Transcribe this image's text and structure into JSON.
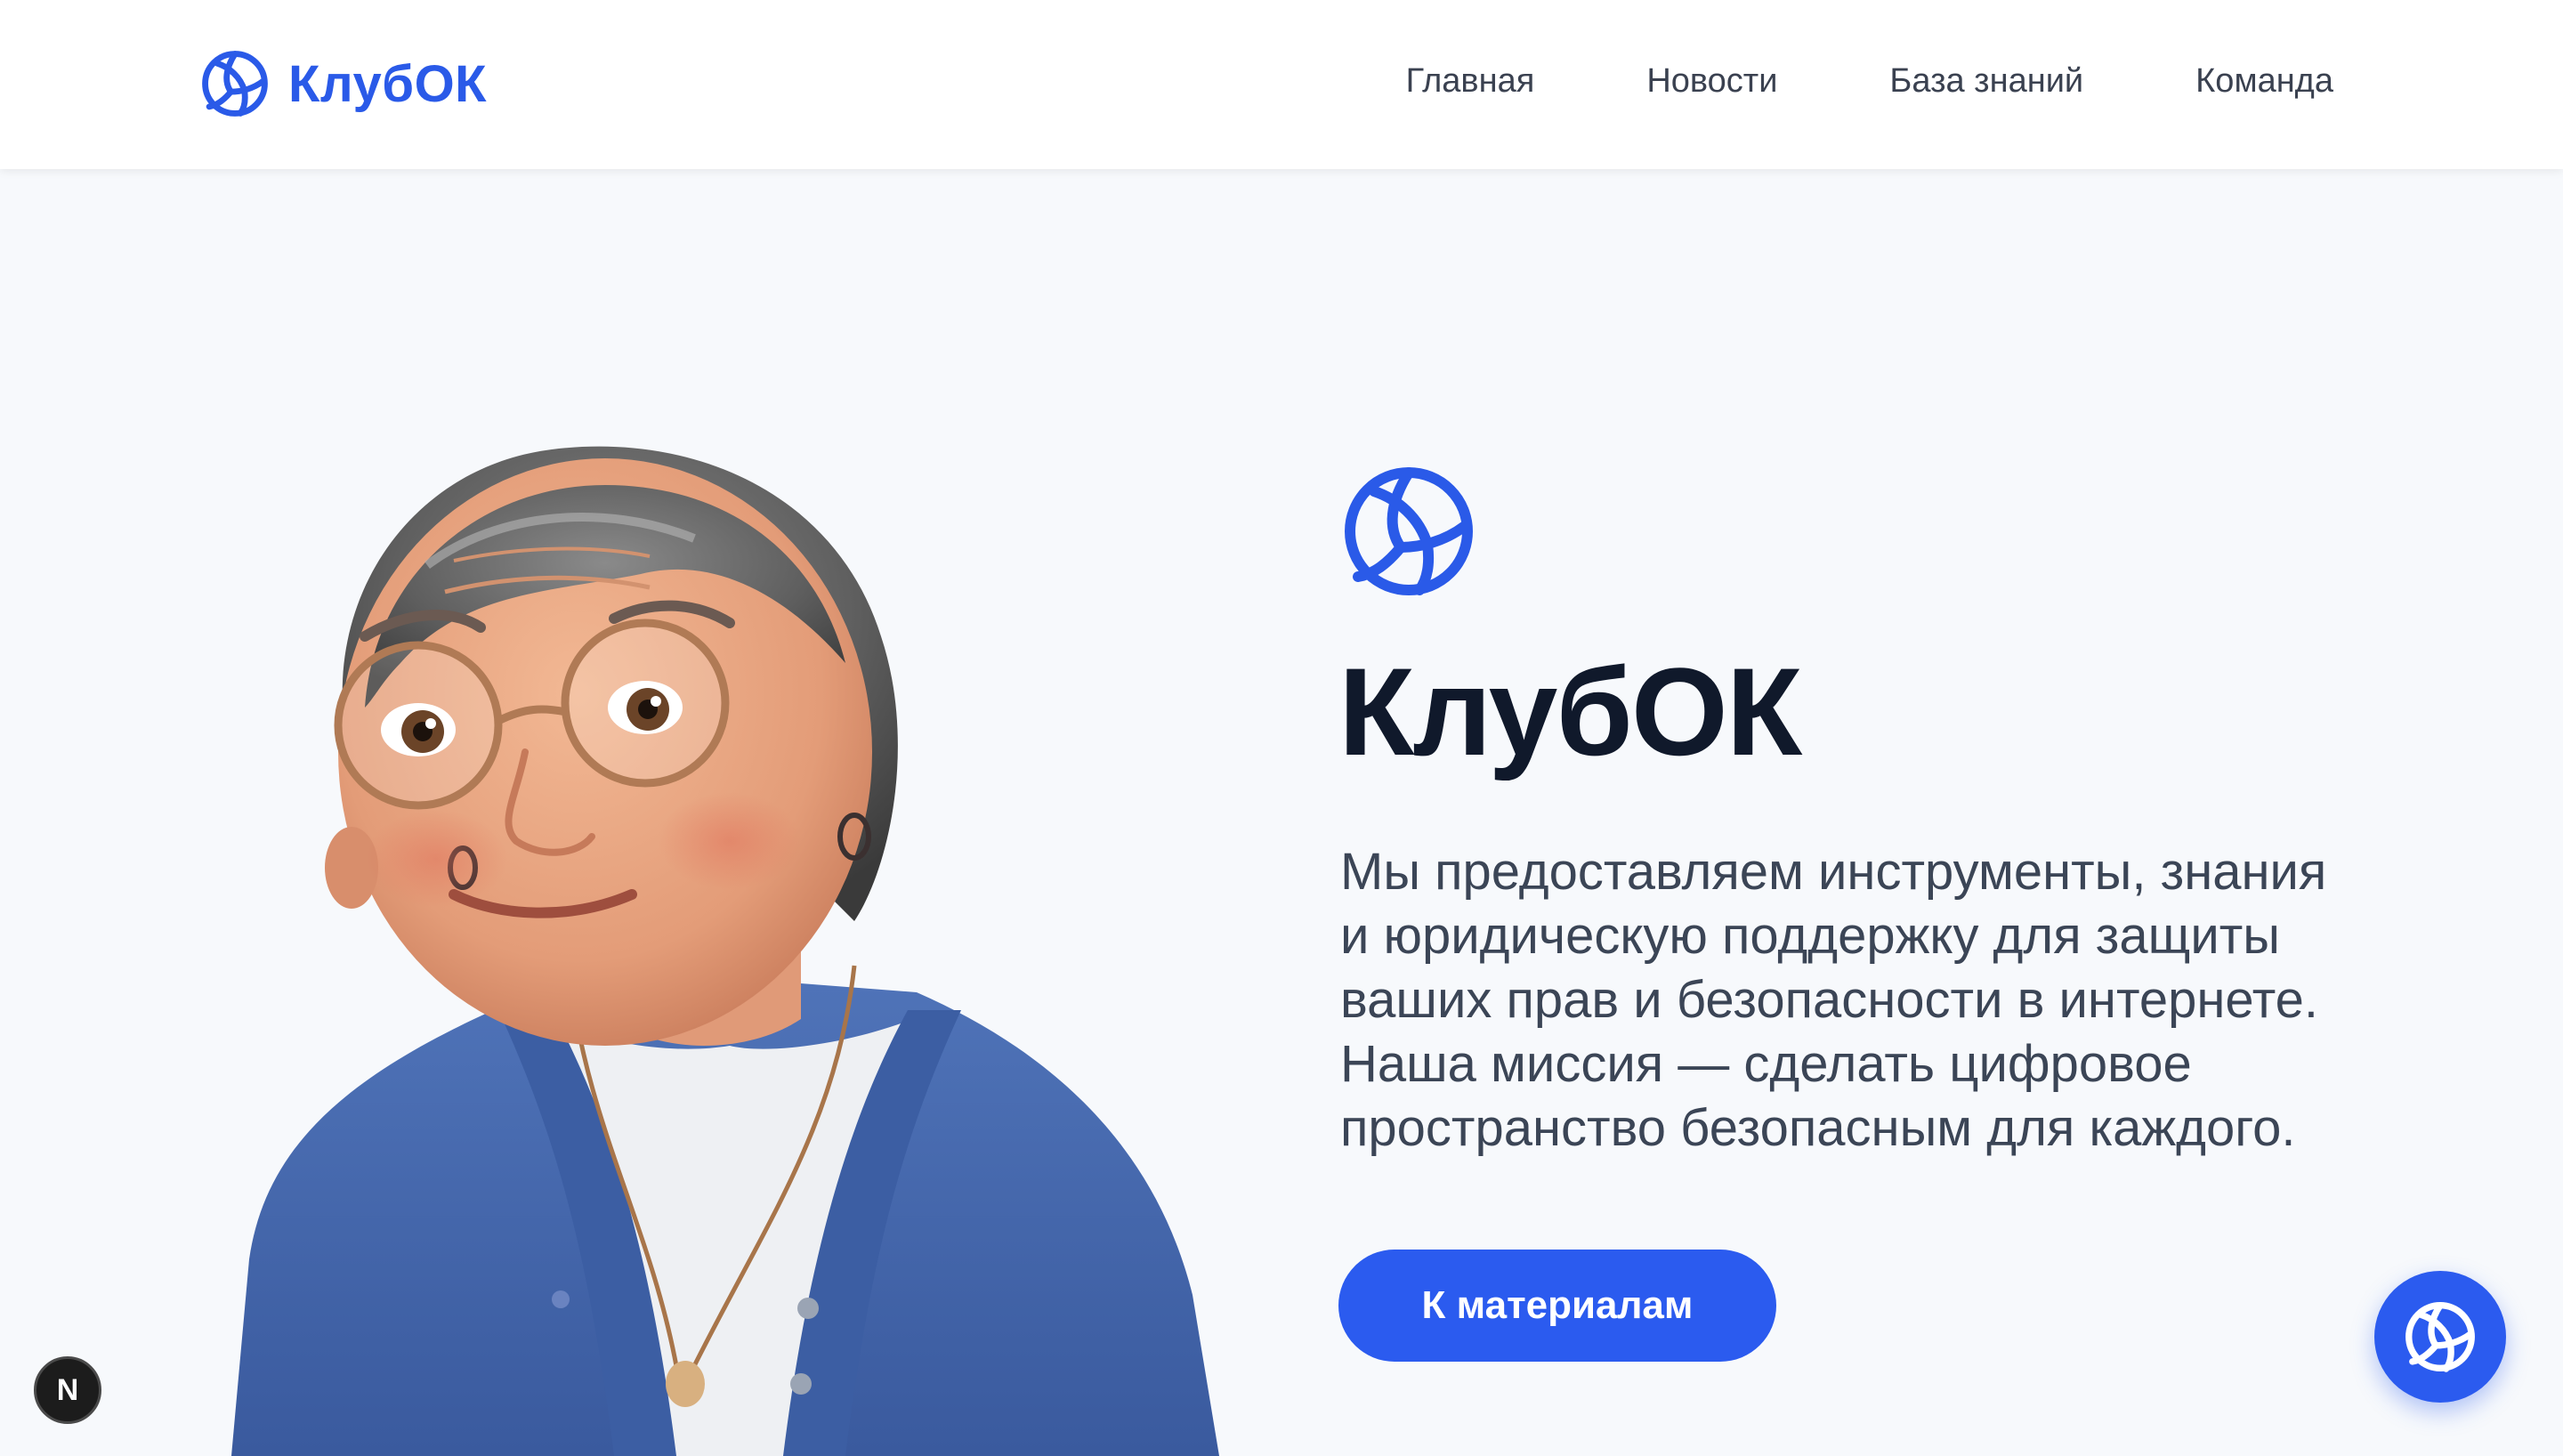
{
  "header": {
    "brand": "КлубОК",
    "nav": [
      "Главная",
      "Новости",
      "База знаний",
      "Команда"
    ]
  },
  "hero": {
    "title": "КлубОК",
    "description_lines": [
      "Мы предоставляем инструменты, знания",
      "и юридическую поддержку для защиты",
      "ваших прав и безопасности в интернете.",
      "Наша миссия — сделать цифровое",
      "пространство безопасным для каждого."
    ],
    "cta_label": "К материалам"
  },
  "dev_badge": "N",
  "icons": {
    "logo": "volleyball-icon",
    "fab": "volleyball-icon",
    "dev_badge": "nextjs-icon"
  },
  "colors": {
    "accent": "#2b5bef",
    "brand_text": "#2a5ae8",
    "title": "#10192b",
    "body": "#3b4556",
    "background": "#f7f9fc"
  }
}
